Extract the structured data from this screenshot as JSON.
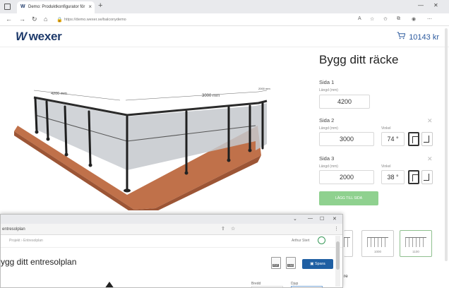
{
  "browser": {
    "tab_title": "Demo: Produktkonfigurator för",
    "url": "https://demo.wexer.se/balconydemo"
  },
  "site": {
    "logo": "wexer",
    "cart_total": "10143 kr"
  },
  "scene": {
    "dim_left": "4200 mm",
    "dim_middle": "3000 mm",
    "dim_right": "2000 mm"
  },
  "config": {
    "title": "Bygg ditt räcke",
    "sides": [
      {
        "label": "Sida 1",
        "length_label": "Längd (mm)",
        "length": "4200"
      },
      {
        "label": "Sida 2",
        "length_label": "Längd (mm)",
        "length": "3000",
        "angle_label": "Vinkel",
        "angle": "74 °"
      },
      {
        "label": "Sida 3",
        "length_label": "Längd (mm)",
        "length": "2000",
        "angle_label": "Vinkel",
        "angle": "38 °"
      }
    ],
    "add_side_label": "LÄGG TILL SIDA",
    "previews": [
      "1000",
      "1100"
    ]
  },
  "win2": {
    "tab_title": "entresolplan",
    "breadcrumb": "Projekt › Entresolplan",
    "user": "Arthur Stert",
    "title": "ygg ditt entresolplan",
    "doc1": "PDF",
    "doc2": "CAD",
    "save_label": "Spara",
    "field1": "Bredd",
    "field2": "Djup"
  },
  "peek_text": "re",
  "colors": {
    "brand": "#1e3a6b",
    "cart": "#2c5a9e",
    "add_button": "#8fd18f",
    "save_button": "#1f5fa3",
    "deck": "#c0714a"
  }
}
